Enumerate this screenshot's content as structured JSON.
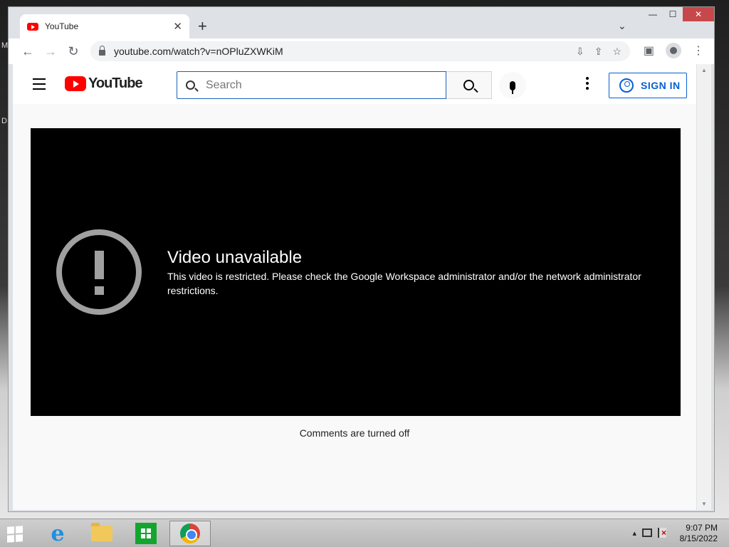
{
  "browser": {
    "tab_title": "YouTube",
    "tab_close": "✕",
    "new_tab": "+",
    "url": "youtube.com/watch?v=nOPluZXWKiM",
    "window_controls": {
      "minimize": "—",
      "maximize": "☐",
      "close": "✕"
    }
  },
  "youtube": {
    "logo_text": "YouTube",
    "search_placeholder": "Search",
    "sign_in_label": "SIGN IN",
    "player": {
      "error_title": "Video unavailable",
      "error_message": "This video is restricted. Please check the Google Workspace administrator and/or the network administrator restrictions."
    },
    "comments_status": "Comments are turned off"
  },
  "taskbar": {
    "clock_time": "9:07 PM",
    "clock_date": "8/15/2022",
    "apps": [
      "internet-explorer",
      "file-explorer",
      "windows-store",
      "chrome"
    ]
  },
  "colors": {
    "youtube_red": "#ff0000",
    "signin_blue": "#065fd4",
    "player_bg": "#000000"
  }
}
